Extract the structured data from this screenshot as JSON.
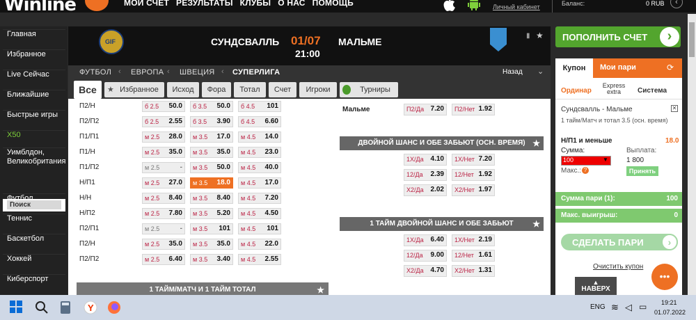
{
  "header": {
    "logo_text": "Winline",
    "nav": [
      "МОИ СЧЕТ",
      "РЕЗУЛЬТАТЫ",
      "КЛУБЫ",
      "О НАС",
      "ПОМОЩЬ"
    ],
    "personal_cabinet": "Личный кабинет",
    "balance_label": "Баланс:",
    "balance_value": "0 RUB"
  },
  "sidebar": {
    "items": [
      "Главная",
      "Избранное",
      "Live Сейчас",
      "Ближайшие",
      "Быстрые игры",
      "X50",
      "Уимблдон, Великобритания",
      "Футбол",
      "Теннис",
      "Баскетбол",
      "Хоккей",
      "Киберспорт"
    ],
    "search": "Поиск"
  },
  "match": {
    "team1": "СУНДСВАЛЛЬ",
    "team2": "МАЛЬМЕ",
    "date": "01/07",
    "time": "21:00",
    "logo1_text": "GIF"
  },
  "breadcrumb": [
    "ФУТБОЛ",
    "ЕВРОПА",
    "ШВЕЦИЯ",
    "СУПЕРЛИГА"
  ],
  "back_label": "Назад",
  "tabs": [
    "Все",
    "Избранное",
    "Исход",
    "Фора",
    "Тотал",
    "Счет",
    "Игроки",
    "Турниры"
  ],
  "left_rows": [
    {
      "label": "П2/Н",
      "cells": [
        [
          "б 2.5",
          "50.0"
        ],
        [
          "б 3.5",
          "50.0"
        ],
        [
          "б 4.5",
          "101"
        ]
      ]
    },
    {
      "label": "П2/П2",
      "cells": [
        [
          "б 2.5",
          "2.55"
        ],
        [
          "б 3.5",
          "3.90"
        ],
        [
          "б 4.5",
          "6.60"
        ]
      ]
    },
    {
      "label": "П1/П1",
      "cells": [
        [
          "м 2.5",
          "28.0"
        ],
        [
          "м 3.5",
          "17.0"
        ],
        [
          "м 4.5",
          "14.0"
        ]
      ]
    },
    {
      "label": "П1/Н",
      "cells": [
        [
          "м 2.5",
          "35.0"
        ],
        [
          "м 3.5",
          "35.0"
        ],
        [
          "м 4.5",
          "23.0"
        ]
      ]
    },
    {
      "label": "П1/П2",
      "cells": [
        [
          "м 2.5",
          "-"
        ],
        [
          "м 3.5",
          "50.0"
        ],
        [
          "м 4.5",
          "40.0"
        ]
      ]
    },
    {
      "label": "Н/П1",
      "cells": [
        [
          "м 2.5",
          "27.0"
        ],
        [
          "м 3.5",
          "18.0"
        ],
        [
          "м 4.5",
          "17.0"
        ]
      ]
    },
    {
      "label": "Н/Н",
      "cells": [
        [
          "м 2.5",
          "8.40"
        ],
        [
          "м 3.5",
          "8.40"
        ],
        [
          "м 4.5",
          "7.20"
        ]
      ]
    },
    {
      "label": "Н/П2",
      "cells": [
        [
          "м 2.5",
          "7.80"
        ],
        [
          "м 3.5",
          "5.20"
        ],
        [
          "м 4.5",
          "4.50"
        ]
      ]
    },
    {
      "label": "П2/П1",
      "cells": [
        [
          "м 2.5",
          "-"
        ],
        [
          "м 3.5",
          "101"
        ],
        [
          "м 4.5",
          "101"
        ]
      ]
    },
    {
      "label": "П2/Н",
      "cells": [
        [
          "м 2.5",
          "35.0"
        ],
        [
          "м 3.5",
          "35.0"
        ],
        [
          "м 4.5",
          "22.0"
        ]
      ]
    },
    {
      "label": "П2/П2",
      "cells": [
        [
          "м 2.5",
          "6.40"
        ],
        [
          "м 3.5",
          "3.40"
        ],
        [
          "м 4.5",
          "2.55"
        ]
      ]
    }
  ],
  "left_bottom_section": "1 ТАЙМ/МАТЧ И 1 ТАЙМ ТОТАЛ",
  "right": {
    "malmo_label": "Мальме",
    "malmo_cells": [
      [
        "П2/Да",
        "7.20"
      ],
      [
        "П2/Нет",
        "1.92"
      ]
    ],
    "sec1_title": "ДВОЙНОЙ ШАНС И ОБЕ ЗАБЬЮТ (ОСН. ВРЕМЯ)",
    "sec1_rows": [
      [
        [
          "1Х/Да",
          "4.10"
        ],
        [
          "1Х/Нет",
          "7.20"
        ]
      ],
      [
        [
          "12/Да",
          "2.39"
        ],
        [
          "12/Нет",
          "1.92"
        ]
      ],
      [
        [
          "Х2/Да",
          "2.02"
        ],
        [
          "Х2/Нет",
          "1.97"
        ]
      ]
    ],
    "sec2_title": "1 ТАЙМ ДВОЙНОЙ ШАНС И ОБЕ ЗАБЬЮТ",
    "sec2_rows": [
      [
        [
          "1Х/Да",
          "6.40"
        ],
        [
          "1Х/Нет",
          "2.19"
        ]
      ],
      [
        [
          "12/Да",
          "9.00"
        ],
        [
          "12/Нет",
          "1.61"
        ]
      ],
      [
        [
          "Х2/Да",
          "4.70"
        ],
        [
          "Х2/Нет",
          "1.31"
        ]
      ]
    ]
  },
  "coupon": {
    "deposit": "ПОПОЛНИТЬ СЧЕТ",
    "tab_coupon": "Купон",
    "tab_mybets": "Мои пари",
    "type_single": "Ординар",
    "type_express": "Express extra",
    "type_system": "Система",
    "match": "Сундсвалль - Мальме",
    "desc": "1 тайм/Матч и тотал 3.5 (осн. время)",
    "bet": "Н/П1 и меньше",
    "odd": "18.0",
    "sum_label": "Сумма:",
    "sum_value": "100",
    "max_label": "Макс.:",
    "payout_label": "Выплата:",
    "payout_value": "1 800",
    "accept": "Принять",
    "total_label": "Сумма пари (1):",
    "total_value": "100",
    "maxwin_label": "Макс. выигрыш:",
    "maxwin_value": "0",
    "place_bet": "СДЕЛАТЬ ПАРИ",
    "clear": "Очистить купон"
  },
  "naverx": "НАВЕРХ",
  "taskbar": {
    "lang": "ENG",
    "time": "19:21",
    "date": "01.07.2022"
  },
  "colors": {
    "accent": "#ee7023",
    "green": "#53a52e",
    "dark": "#111111"
  }
}
